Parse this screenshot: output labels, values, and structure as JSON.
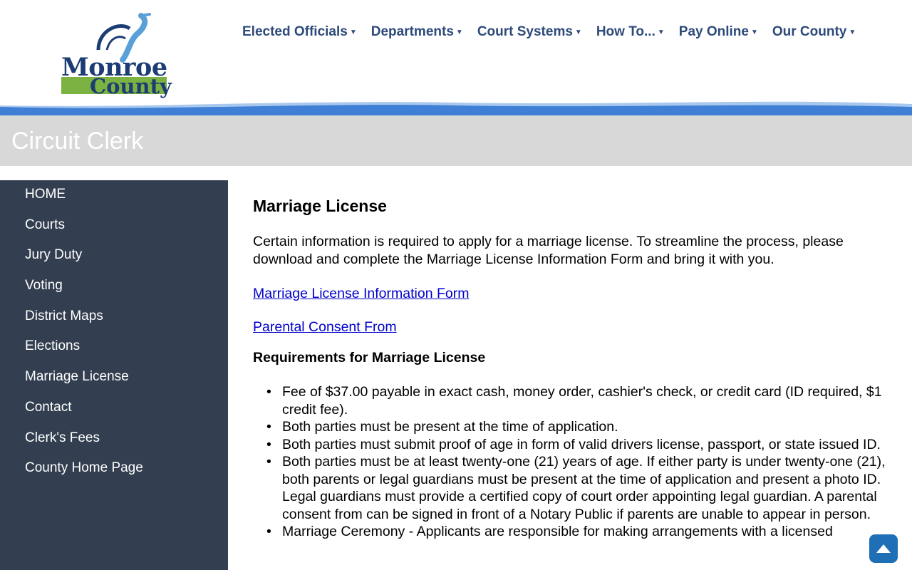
{
  "logo": {
    "line1": "Monroe",
    "line2": "County"
  },
  "nav": [
    {
      "label": "Elected Officials"
    },
    {
      "label": "Departments"
    },
    {
      "label": "Court Systems"
    },
    {
      "label": "How To..."
    },
    {
      "label": "Pay Online"
    },
    {
      "label": "Our County"
    }
  ],
  "page_title": "Circuit Clerk",
  "sidebar": [
    {
      "label": "HOME"
    },
    {
      "label": "Courts"
    },
    {
      "label": "Jury Duty"
    },
    {
      "label": "Voting"
    },
    {
      "label": "District Maps"
    },
    {
      "label": "Elections"
    },
    {
      "label": "Marriage License"
    },
    {
      "label": "Contact"
    },
    {
      "label": "Clerk's Fees"
    },
    {
      "label": "County Home Page"
    }
  ],
  "main": {
    "heading": "Marriage License",
    "intro": "Certain information is required to apply for a marriage license.  To streamline the process, please download and complete the Marriage License Information Form and bring it with you.",
    "link_form": "Marriage License Information Form",
    "link_consent": "Parental Consent From",
    "req_heading": "Requirements for Marriage License",
    "requirements": [
      "Fee of $37.00 payable in exact cash, money order, cashier's check, or credit card (ID required, $1 credit fee).",
      "Both parties must be present at the time of application.",
      "Both parties must submit proof of age in form of valid drivers license, passport, or state issued ID.",
      "Both parties must be at least twenty-one (21) years of age.  If either party is under twenty-one (21), both parents or legal guardians must be present at the time of application and present a photo ID.  Legal guardians must provide a certified copy of court order appointing legal guardian.  A parental consent from can be signed in front of a Notary Public if parents are unable to appear in person.",
      "Marriage Ceremony - Applicants are responsible for making arrangements with a licensed"
    ]
  },
  "colors": {
    "nav_text": "#2d4a7a",
    "sidebar_bg": "#333f50",
    "title_bg": "#d8d8d8",
    "wave": "#3f7fd6",
    "logo_green": "#7bb242"
  }
}
